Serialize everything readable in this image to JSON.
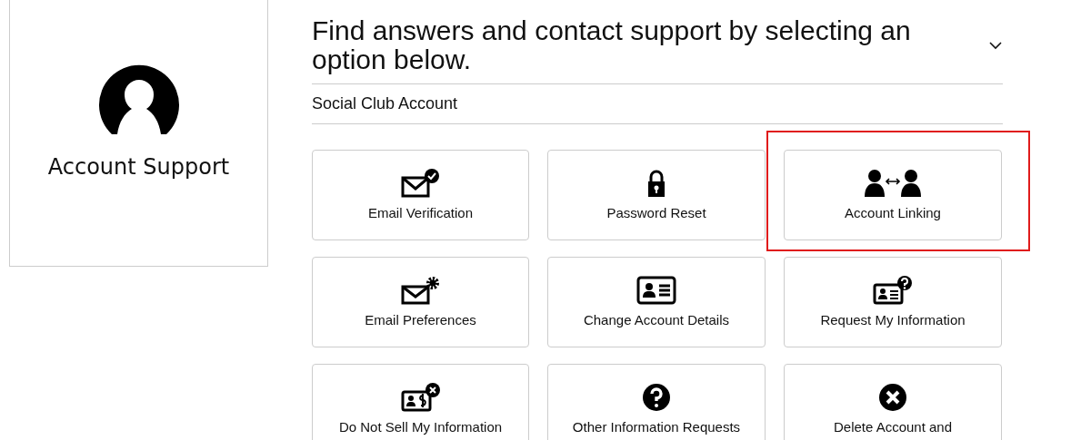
{
  "sidebar": {
    "title": "Account Support"
  },
  "header": {
    "title": "Find answers and contact support by selecting an option below.",
    "expanded": true
  },
  "section": {
    "title": "Social Club Account"
  },
  "options": [
    {
      "label": "Email Verification",
      "highlighted": false
    },
    {
      "label": "Password Reset",
      "highlighted": false
    },
    {
      "label": "Account Linking",
      "highlighted": true
    },
    {
      "label": "Email Preferences",
      "highlighted": false
    },
    {
      "label": "Change Account Details",
      "highlighted": false
    },
    {
      "label": "Request My Information",
      "highlighted": false
    },
    {
      "label": "Do Not Sell My Information",
      "highlighted": false
    },
    {
      "label": "Other Information Requests",
      "highlighted": false
    },
    {
      "label": "Delete Account and",
      "highlighted": false
    }
  ]
}
